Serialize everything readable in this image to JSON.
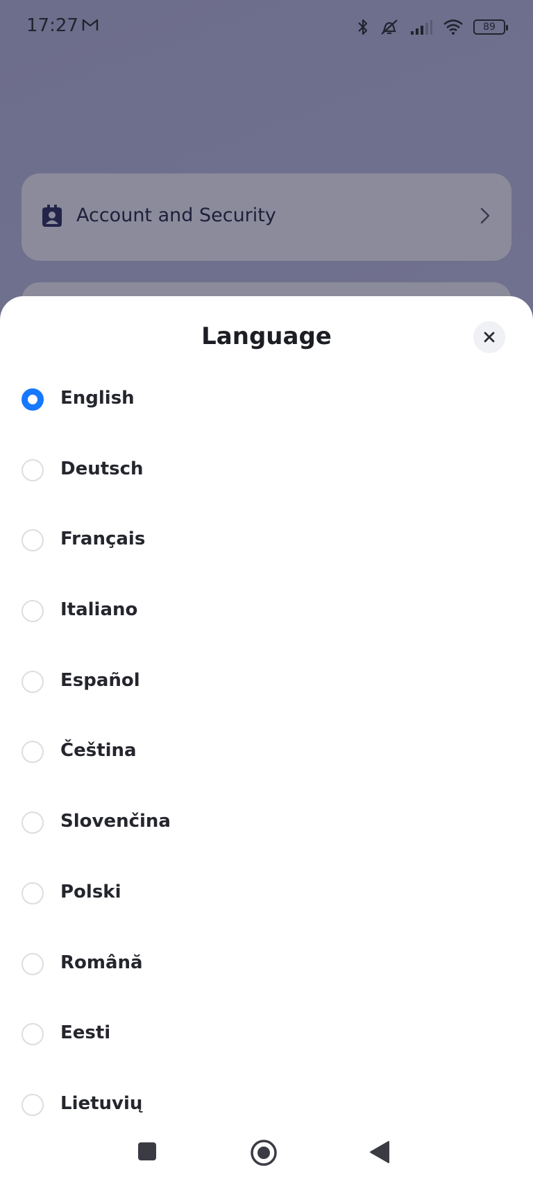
{
  "status_bar": {
    "time": "17:27",
    "mail_icon": "gmail-icon",
    "battery": "89",
    "icons": [
      "bluetooth-icon",
      "mute-icon",
      "signal-icon",
      "wifi-icon",
      "battery-icon"
    ]
  },
  "background": {
    "card_label": "Account and Security",
    "card_icon": "contact-card-icon"
  },
  "sheet": {
    "title": "Language",
    "close_icon": "close-icon",
    "accent_color": "#1677ff",
    "selected": "English",
    "languages": [
      {
        "label": "English",
        "selected": true
      },
      {
        "label": "Deutsch",
        "selected": false
      },
      {
        "label": "Français",
        "selected": false
      },
      {
        "label": "Italiano",
        "selected": false
      },
      {
        "label": "Español",
        "selected": false
      },
      {
        "label": "Čeština",
        "selected": false
      },
      {
        "label": "Slovenčina",
        "selected": false
      },
      {
        "label": "Polski",
        "selected": false
      },
      {
        "label": "Română",
        "selected": false
      },
      {
        "label": "Eesti",
        "selected": false
      },
      {
        "label": "Lietuvių",
        "selected": false
      }
    ]
  },
  "navbar": {
    "buttons": [
      "recents-square-icon",
      "home-circle-icon",
      "back-triangle-icon"
    ]
  }
}
